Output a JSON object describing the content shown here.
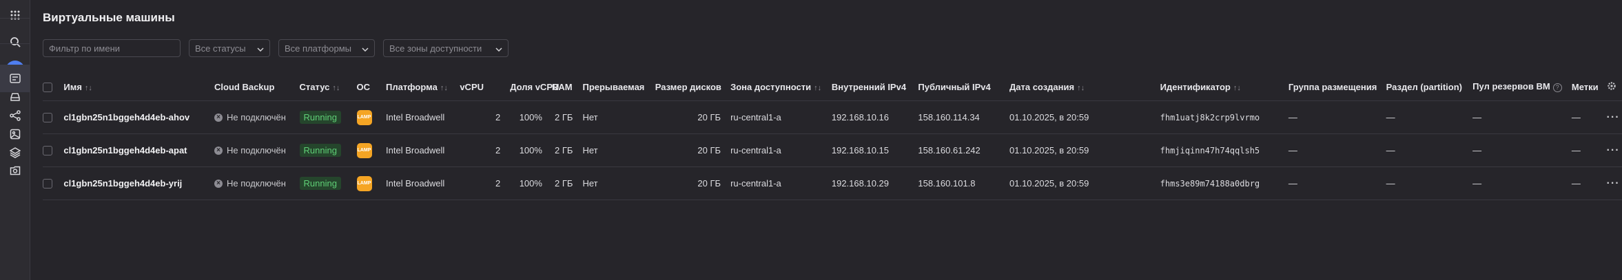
{
  "sidebar": {
    "icons": [
      "apps-grid-icon",
      "search-icon",
      "settings-icon",
      "compute-icon",
      "disk-icon",
      "network-icon",
      "image-icon",
      "layers-icon",
      "snapshot-icon"
    ]
  },
  "page": {
    "title": "Виртуальные машины"
  },
  "filters": {
    "name_placeholder": "Фильтр по имени",
    "status": "Все статусы",
    "platform": "Все платформы",
    "zone": "Все зоны доступности"
  },
  "table": {
    "headers": {
      "name": "Имя",
      "backup": "Cloud Backup",
      "status": "Статус",
      "os": "ОС",
      "platform": "Платформа",
      "vcpu": "vCPU",
      "vcpu_share": "Доля vCPU",
      "ram": "RAM",
      "preemptible": "Прерываемая",
      "disk_size": "Размер дисков",
      "zone": "Зона доступности",
      "internal_ip": "Внутренний IPv4",
      "public_ip": "Публичный IPv4",
      "created": "Дата создания",
      "id": "Идентификатор",
      "placement_group": "Группа размещения",
      "partition": "Раздел (partition)",
      "reserve_pool": "Пул резервов ВМ",
      "labels": "Метки"
    },
    "rows": [
      {
        "name": "cl1gbn25n1bggeh4d4eb-ahov",
        "backup": "Не подключён",
        "status": "Running",
        "os_label": "LAMP",
        "platform": "Intel Broadwell",
        "vcpu": "2",
        "vcpu_share": "100%",
        "ram": "2 ГБ",
        "preemptible": "Нет",
        "disk_size": "20 ГБ",
        "zone": "ru-central1-a",
        "internal_ip": "192.168.10.16",
        "public_ip": "158.160.114.34",
        "created": "01.10.2025, в 20:59",
        "id": "fhm1uatj8k2crp9lvrmo",
        "placement_group": "—",
        "partition": "—",
        "reserve_pool": "—",
        "labels": "—"
      },
      {
        "name": "cl1gbn25n1bggeh4d4eb-apat",
        "backup": "Не подключён",
        "status": "Running",
        "os_label": "LAMP",
        "platform": "Intel Broadwell",
        "vcpu": "2",
        "vcpu_share": "100%",
        "ram": "2 ГБ",
        "preemptible": "Нет",
        "disk_size": "20 ГБ",
        "zone": "ru-central1-a",
        "internal_ip": "192.168.10.15",
        "public_ip": "158.160.61.242",
        "created": "01.10.2025, в 20:59",
        "id": "fhmjiqinn47h74qqlsh5",
        "placement_group": "—",
        "partition": "—",
        "reserve_pool": "—",
        "labels": "—"
      },
      {
        "name": "cl1gbn25n1bggeh4d4eb-yrij",
        "backup": "Не подключён",
        "status": "Running",
        "os_label": "LAMP",
        "platform": "Intel Broadwell",
        "vcpu": "2",
        "vcpu_share": "100%",
        "ram": "2 ГБ",
        "preemptible": "Нет",
        "disk_size": "20 ГБ",
        "zone": "ru-central1-a",
        "internal_ip": "192.168.10.29",
        "public_ip": "158.160.101.8",
        "created": "01.10.2025, в 20:59",
        "id": "fhms3e89m74188a0dbrg",
        "placement_group": "—",
        "partition": "—",
        "reserve_pool": "—",
        "labels": "—"
      }
    ]
  },
  "colors": {
    "background": "#26252a",
    "accent": "#4f7ef0",
    "running_bg": "#25452c",
    "running_text": "#5fcf76",
    "os_icon": "#f5a524"
  }
}
